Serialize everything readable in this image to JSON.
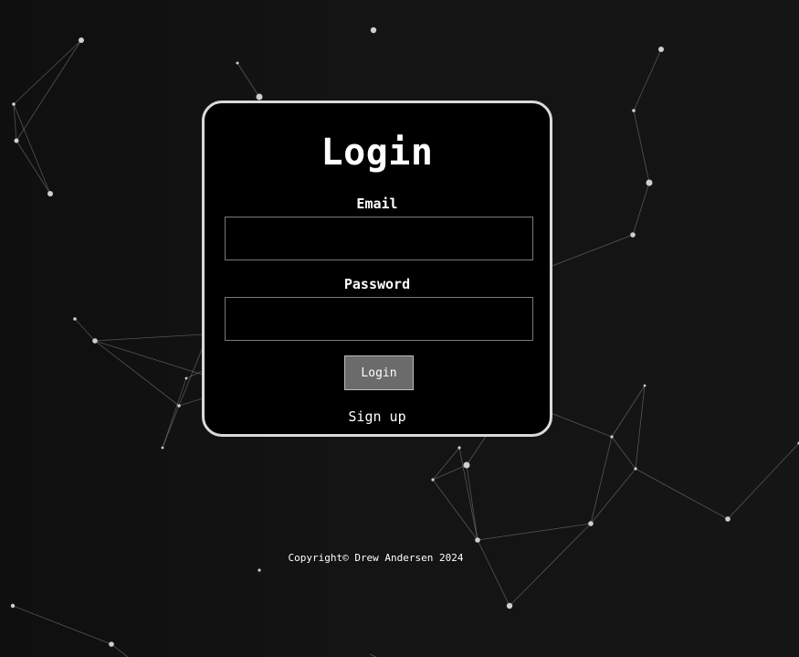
{
  "login_card": {
    "title": "Login",
    "email_label": "Email",
    "email_value": "",
    "password_label": "Password",
    "password_value": "",
    "login_button": "Login",
    "signup_link": "Sign up"
  },
  "footer": {
    "copyright": "Copyright© Drew Andersen 2024"
  },
  "colors": {
    "background": "#121212",
    "card_background": "#000000",
    "card_border": "#d9d9d9",
    "button_background": "#6b6b6b",
    "text": "#ffffff"
  }
}
